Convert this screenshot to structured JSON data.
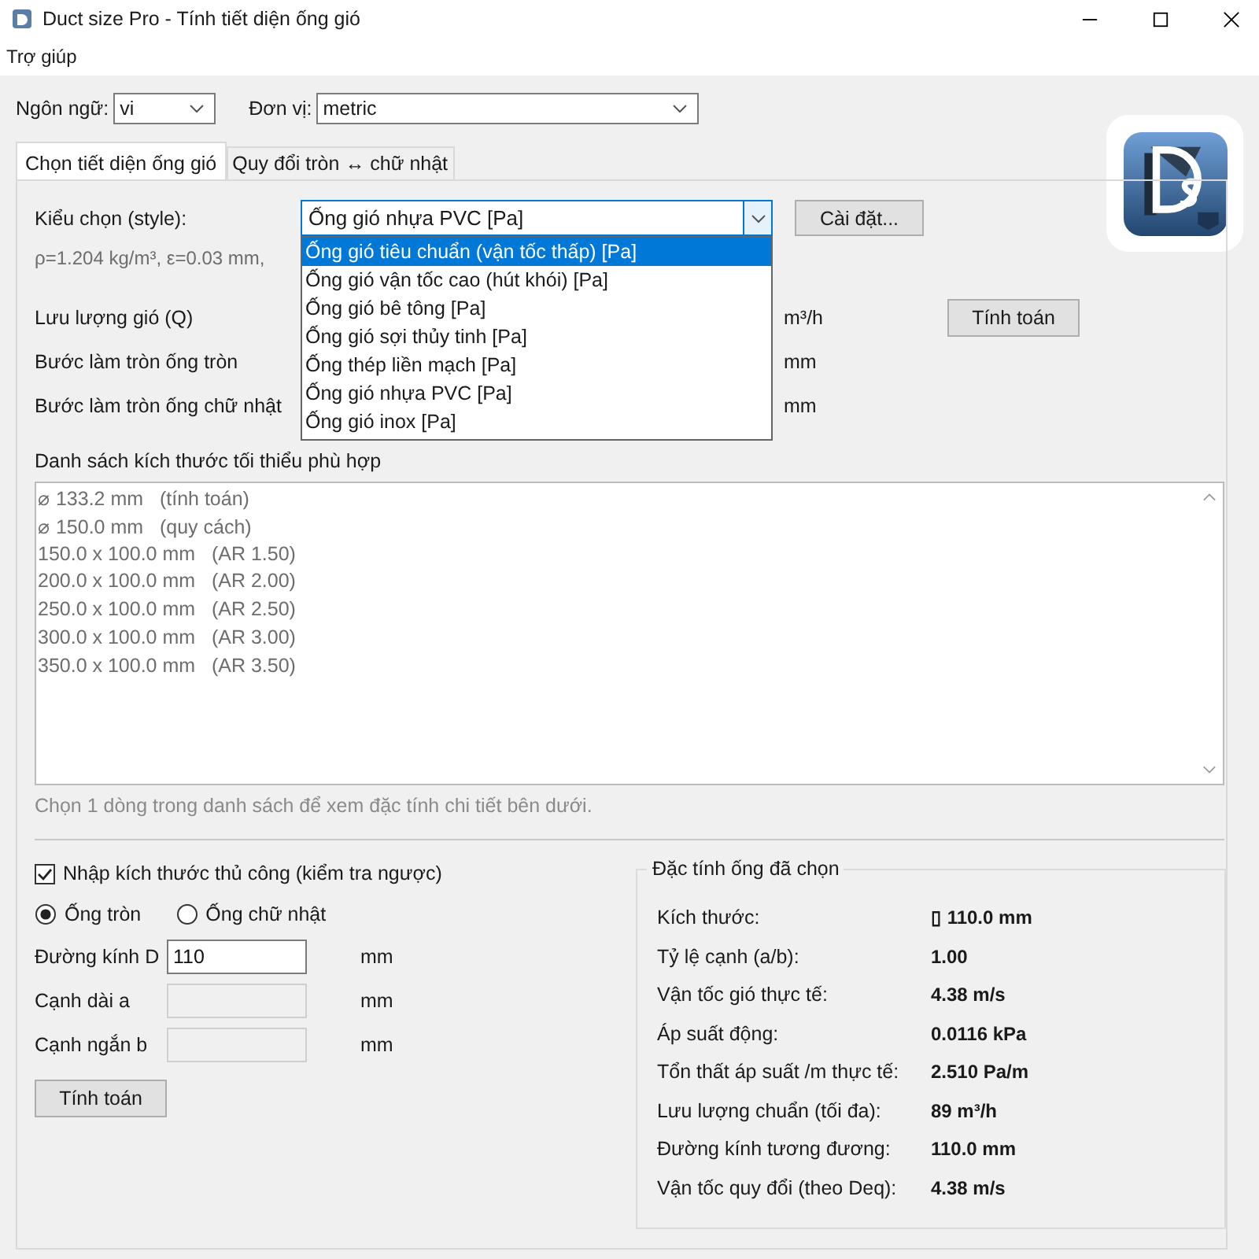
{
  "window": {
    "title": "Duct size Pro - Tính tiết diện ống gió"
  },
  "menu": [
    "Trợ giúp"
  ],
  "toolbar": {
    "language": {
      "label": "Ngôn ngữ:",
      "value": "vi"
    },
    "unit": {
      "label": "Đơn vị:",
      "value": "metric"
    }
  },
  "tabs": [
    {
      "label": "Chọn tiết diện ống gió",
      "selected": true
    },
    {
      "label": "Quy đổi tròn ↔ chữ nhật",
      "selected": false
    }
  ],
  "style": {
    "label": "Kiểu chọn (style):",
    "value": "Ống gió nhựa PVC [Pa]",
    "expanded": true,
    "options": [
      {
        "label": "Ống gió tiêu chuẩn (vận tốc thấp) [Pa]",
        "highlighted": true
      },
      {
        "label": "Ống gió vận tốc cao (hút khói) [Pa]",
        "highlighted": false
      },
      {
        "label": "Ống gió bê tông [Pa]",
        "highlighted": false
      },
      {
        "label": "Ống gió sợi thủy tinh [Pa]",
        "highlighted": false
      },
      {
        "label": "Ống thép liền mạch [Pa]",
        "highlighted": false
      },
      {
        "label": "Ống gió nhựa PVC [Pa]",
        "highlighted": false
      },
      {
        "label": "Ống gió inox [Pa]",
        "highlighted": false
      }
    ]
  },
  "settings_button": "Cài đặt...",
  "parameters": "ρ=1.204 kg/m³, ε=0.03 mm,",
  "inputs": [
    {
      "label": "Lưu lượng gió (Q)",
      "unit": "m³/h"
    },
    {
      "label": "Bước làm tròn ống tròn",
      "unit": "mm"
    },
    {
      "label": "Bước làm tròn ống chữ nhật",
      "unit": "mm"
    }
  ],
  "calculate_button": "Tính toán",
  "size_list": {
    "title": "Danh sách kích thước tối thiểu phù hợp",
    "items": [
      "⌀ 133.2 mm   (tính toán)",
      "⌀ 150.0 mm   (quy cách)",
      "150.0 x 100.0 mm   (AR 1.50)",
      "200.0 x 100.0 mm   (AR 2.00)",
      "250.0 x 100.0 mm   (AR 2.50)",
      "300.0 x 100.0 mm   (AR 3.00)",
      "350.0 x 100.0 mm   (AR 3.50)"
    ],
    "hint": "Chọn 1 dòng trong danh sách để xem đặc tính chi tiết bên dưới."
  },
  "manual": {
    "checkbox": {
      "label": "Nhập kích thước thủ công (kiểm tra ngược)",
      "checked": true
    },
    "shapes": [
      {
        "label": "Ống tròn",
        "selected": true
      },
      {
        "label": "Ống chữ nhật",
        "selected": false
      }
    ],
    "fields": [
      {
        "label": "Đường kính D",
        "value": "110",
        "disabled": false,
        "unit": "mm"
      },
      {
        "label": "Cạnh dài a",
        "disabled": true,
        "unit": "mm"
      },
      {
        "label": "Cạnh ngắn b",
        "disabled": true,
        "unit": "mm"
      }
    ],
    "calculate_button": "Tính toán"
  },
  "properties": {
    "title": "Đặc tính ống đã chọn",
    "rows": [
      {
        "label": "Kích thước:",
        "value": "▯ 110.0 mm"
      },
      {
        "label": "Tỷ lệ cạnh (a/b):",
        "value": "1.00"
      },
      {
        "label": "Vận tốc gió thực tế:",
        "value": "4.38 m/s"
      },
      {
        "label": "Áp suất động:",
        "value": "0.0116 kPa"
      },
      {
        "label": "Tổn thất áp suất /m thực tế:",
        "value": "2.510 Pa/m"
      },
      {
        "label": "Lưu lượng chuẩn (tối đa):",
        "value": "89 m³/h"
      },
      {
        "label": "Đường kính tương đương:",
        "value": "110.0 mm"
      },
      {
        "label": "Vận tốc quy đổi (theo Deq):",
        "value": "4.38 m/s"
      }
    ]
  }
}
